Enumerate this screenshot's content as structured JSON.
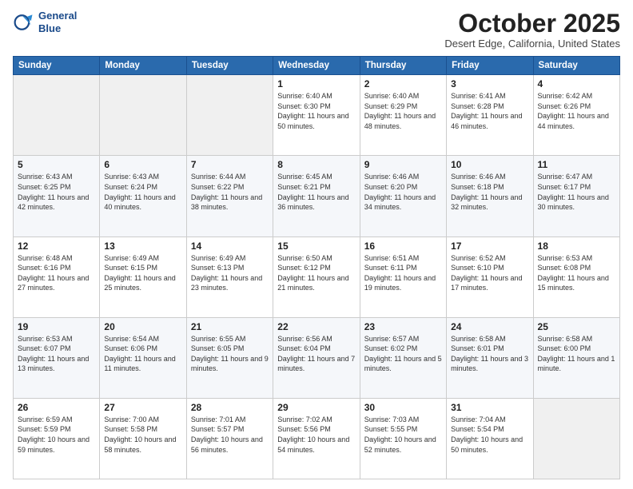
{
  "header": {
    "logo_line1": "General",
    "logo_line2": "Blue",
    "month": "October 2025",
    "location": "Desert Edge, California, United States"
  },
  "weekdays": [
    "Sunday",
    "Monday",
    "Tuesday",
    "Wednesday",
    "Thursday",
    "Friday",
    "Saturday"
  ],
  "weeks": [
    [
      {
        "day": "",
        "sunrise": "",
        "sunset": "",
        "daylight": "",
        "empty": true
      },
      {
        "day": "",
        "sunrise": "",
        "sunset": "",
        "daylight": "",
        "empty": true
      },
      {
        "day": "",
        "sunrise": "",
        "sunset": "",
        "daylight": "",
        "empty": true
      },
      {
        "day": "1",
        "sunrise": "Sunrise: 6:40 AM",
        "sunset": "Sunset: 6:30 PM",
        "daylight": "Daylight: 11 hours and 50 minutes."
      },
      {
        "day": "2",
        "sunrise": "Sunrise: 6:40 AM",
        "sunset": "Sunset: 6:29 PM",
        "daylight": "Daylight: 11 hours and 48 minutes."
      },
      {
        "day": "3",
        "sunrise": "Sunrise: 6:41 AM",
        "sunset": "Sunset: 6:28 PM",
        "daylight": "Daylight: 11 hours and 46 minutes."
      },
      {
        "day": "4",
        "sunrise": "Sunrise: 6:42 AM",
        "sunset": "Sunset: 6:26 PM",
        "daylight": "Daylight: 11 hours and 44 minutes."
      }
    ],
    [
      {
        "day": "5",
        "sunrise": "Sunrise: 6:43 AM",
        "sunset": "Sunset: 6:25 PM",
        "daylight": "Daylight: 11 hours and 42 minutes."
      },
      {
        "day": "6",
        "sunrise": "Sunrise: 6:43 AM",
        "sunset": "Sunset: 6:24 PM",
        "daylight": "Daylight: 11 hours and 40 minutes."
      },
      {
        "day": "7",
        "sunrise": "Sunrise: 6:44 AM",
        "sunset": "Sunset: 6:22 PM",
        "daylight": "Daylight: 11 hours and 38 minutes."
      },
      {
        "day": "8",
        "sunrise": "Sunrise: 6:45 AM",
        "sunset": "Sunset: 6:21 PM",
        "daylight": "Daylight: 11 hours and 36 minutes."
      },
      {
        "day": "9",
        "sunrise": "Sunrise: 6:46 AM",
        "sunset": "Sunset: 6:20 PM",
        "daylight": "Daylight: 11 hours and 34 minutes."
      },
      {
        "day": "10",
        "sunrise": "Sunrise: 6:46 AM",
        "sunset": "Sunset: 6:18 PM",
        "daylight": "Daylight: 11 hours and 32 minutes."
      },
      {
        "day": "11",
        "sunrise": "Sunrise: 6:47 AM",
        "sunset": "Sunset: 6:17 PM",
        "daylight": "Daylight: 11 hours and 30 minutes."
      }
    ],
    [
      {
        "day": "12",
        "sunrise": "Sunrise: 6:48 AM",
        "sunset": "Sunset: 6:16 PM",
        "daylight": "Daylight: 11 hours and 27 minutes."
      },
      {
        "day": "13",
        "sunrise": "Sunrise: 6:49 AM",
        "sunset": "Sunset: 6:15 PM",
        "daylight": "Daylight: 11 hours and 25 minutes."
      },
      {
        "day": "14",
        "sunrise": "Sunrise: 6:49 AM",
        "sunset": "Sunset: 6:13 PM",
        "daylight": "Daylight: 11 hours and 23 minutes."
      },
      {
        "day": "15",
        "sunrise": "Sunrise: 6:50 AM",
        "sunset": "Sunset: 6:12 PM",
        "daylight": "Daylight: 11 hours and 21 minutes."
      },
      {
        "day": "16",
        "sunrise": "Sunrise: 6:51 AM",
        "sunset": "Sunset: 6:11 PM",
        "daylight": "Daylight: 11 hours and 19 minutes."
      },
      {
        "day": "17",
        "sunrise": "Sunrise: 6:52 AM",
        "sunset": "Sunset: 6:10 PM",
        "daylight": "Daylight: 11 hours and 17 minutes."
      },
      {
        "day": "18",
        "sunrise": "Sunrise: 6:53 AM",
        "sunset": "Sunset: 6:08 PM",
        "daylight": "Daylight: 11 hours and 15 minutes."
      }
    ],
    [
      {
        "day": "19",
        "sunrise": "Sunrise: 6:53 AM",
        "sunset": "Sunset: 6:07 PM",
        "daylight": "Daylight: 11 hours and 13 minutes."
      },
      {
        "day": "20",
        "sunrise": "Sunrise: 6:54 AM",
        "sunset": "Sunset: 6:06 PM",
        "daylight": "Daylight: 11 hours and 11 minutes."
      },
      {
        "day": "21",
        "sunrise": "Sunrise: 6:55 AM",
        "sunset": "Sunset: 6:05 PM",
        "daylight": "Daylight: 11 hours and 9 minutes."
      },
      {
        "day": "22",
        "sunrise": "Sunrise: 6:56 AM",
        "sunset": "Sunset: 6:04 PM",
        "daylight": "Daylight: 11 hours and 7 minutes."
      },
      {
        "day": "23",
        "sunrise": "Sunrise: 6:57 AM",
        "sunset": "Sunset: 6:02 PM",
        "daylight": "Daylight: 11 hours and 5 minutes."
      },
      {
        "day": "24",
        "sunrise": "Sunrise: 6:58 AM",
        "sunset": "Sunset: 6:01 PM",
        "daylight": "Daylight: 11 hours and 3 minutes."
      },
      {
        "day": "25",
        "sunrise": "Sunrise: 6:58 AM",
        "sunset": "Sunset: 6:00 PM",
        "daylight": "Daylight: 11 hours and 1 minute."
      }
    ],
    [
      {
        "day": "26",
        "sunrise": "Sunrise: 6:59 AM",
        "sunset": "Sunset: 5:59 PM",
        "daylight": "Daylight: 10 hours and 59 minutes."
      },
      {
        "day": "27",
        "sunrise": "Sunrise: 7:00 AM",
        "sunset": "Sunset: 5:58 PM",
        "daylight": "Daylight: 10 hours and 58 minutes."
      },
      {
        "day": "28",
        "sunrise": "Sunrise: 7:01 AM",
        "sunset": "Sunset: 5:57 PM",
        "daylight": "Daylight: 10 hours and 56 minutes."
      },
      {
        "day": "29",
        "sunrise": "Sunrise: 7:02 AM",
        "sunset": "Sunset: 5:56 PM",
        "daylight": "Daylight: 10 hours and 54 minutes."
      },
      {
        "day": "30",
        "sunrise": "Sunrise: 7:03 AM",
        "sunset": "Sunset: 5:55 PM",
        "daylight": "Daylight: 10 hours and 52 minutes."
      },
      {
        "day": "31",
        "sunrise": "Sunrise: 7:04 AM",
        "sunset": "Sunset: 5:54 PM",
        "daylight": "Daylight: 10 hours and 50 minutes."
      },
      {
        "day": "",
        "sunrise": "",
        "sunset": "",
        "daylight": "",
        "empty": true
      }
    ]
  ]
}
